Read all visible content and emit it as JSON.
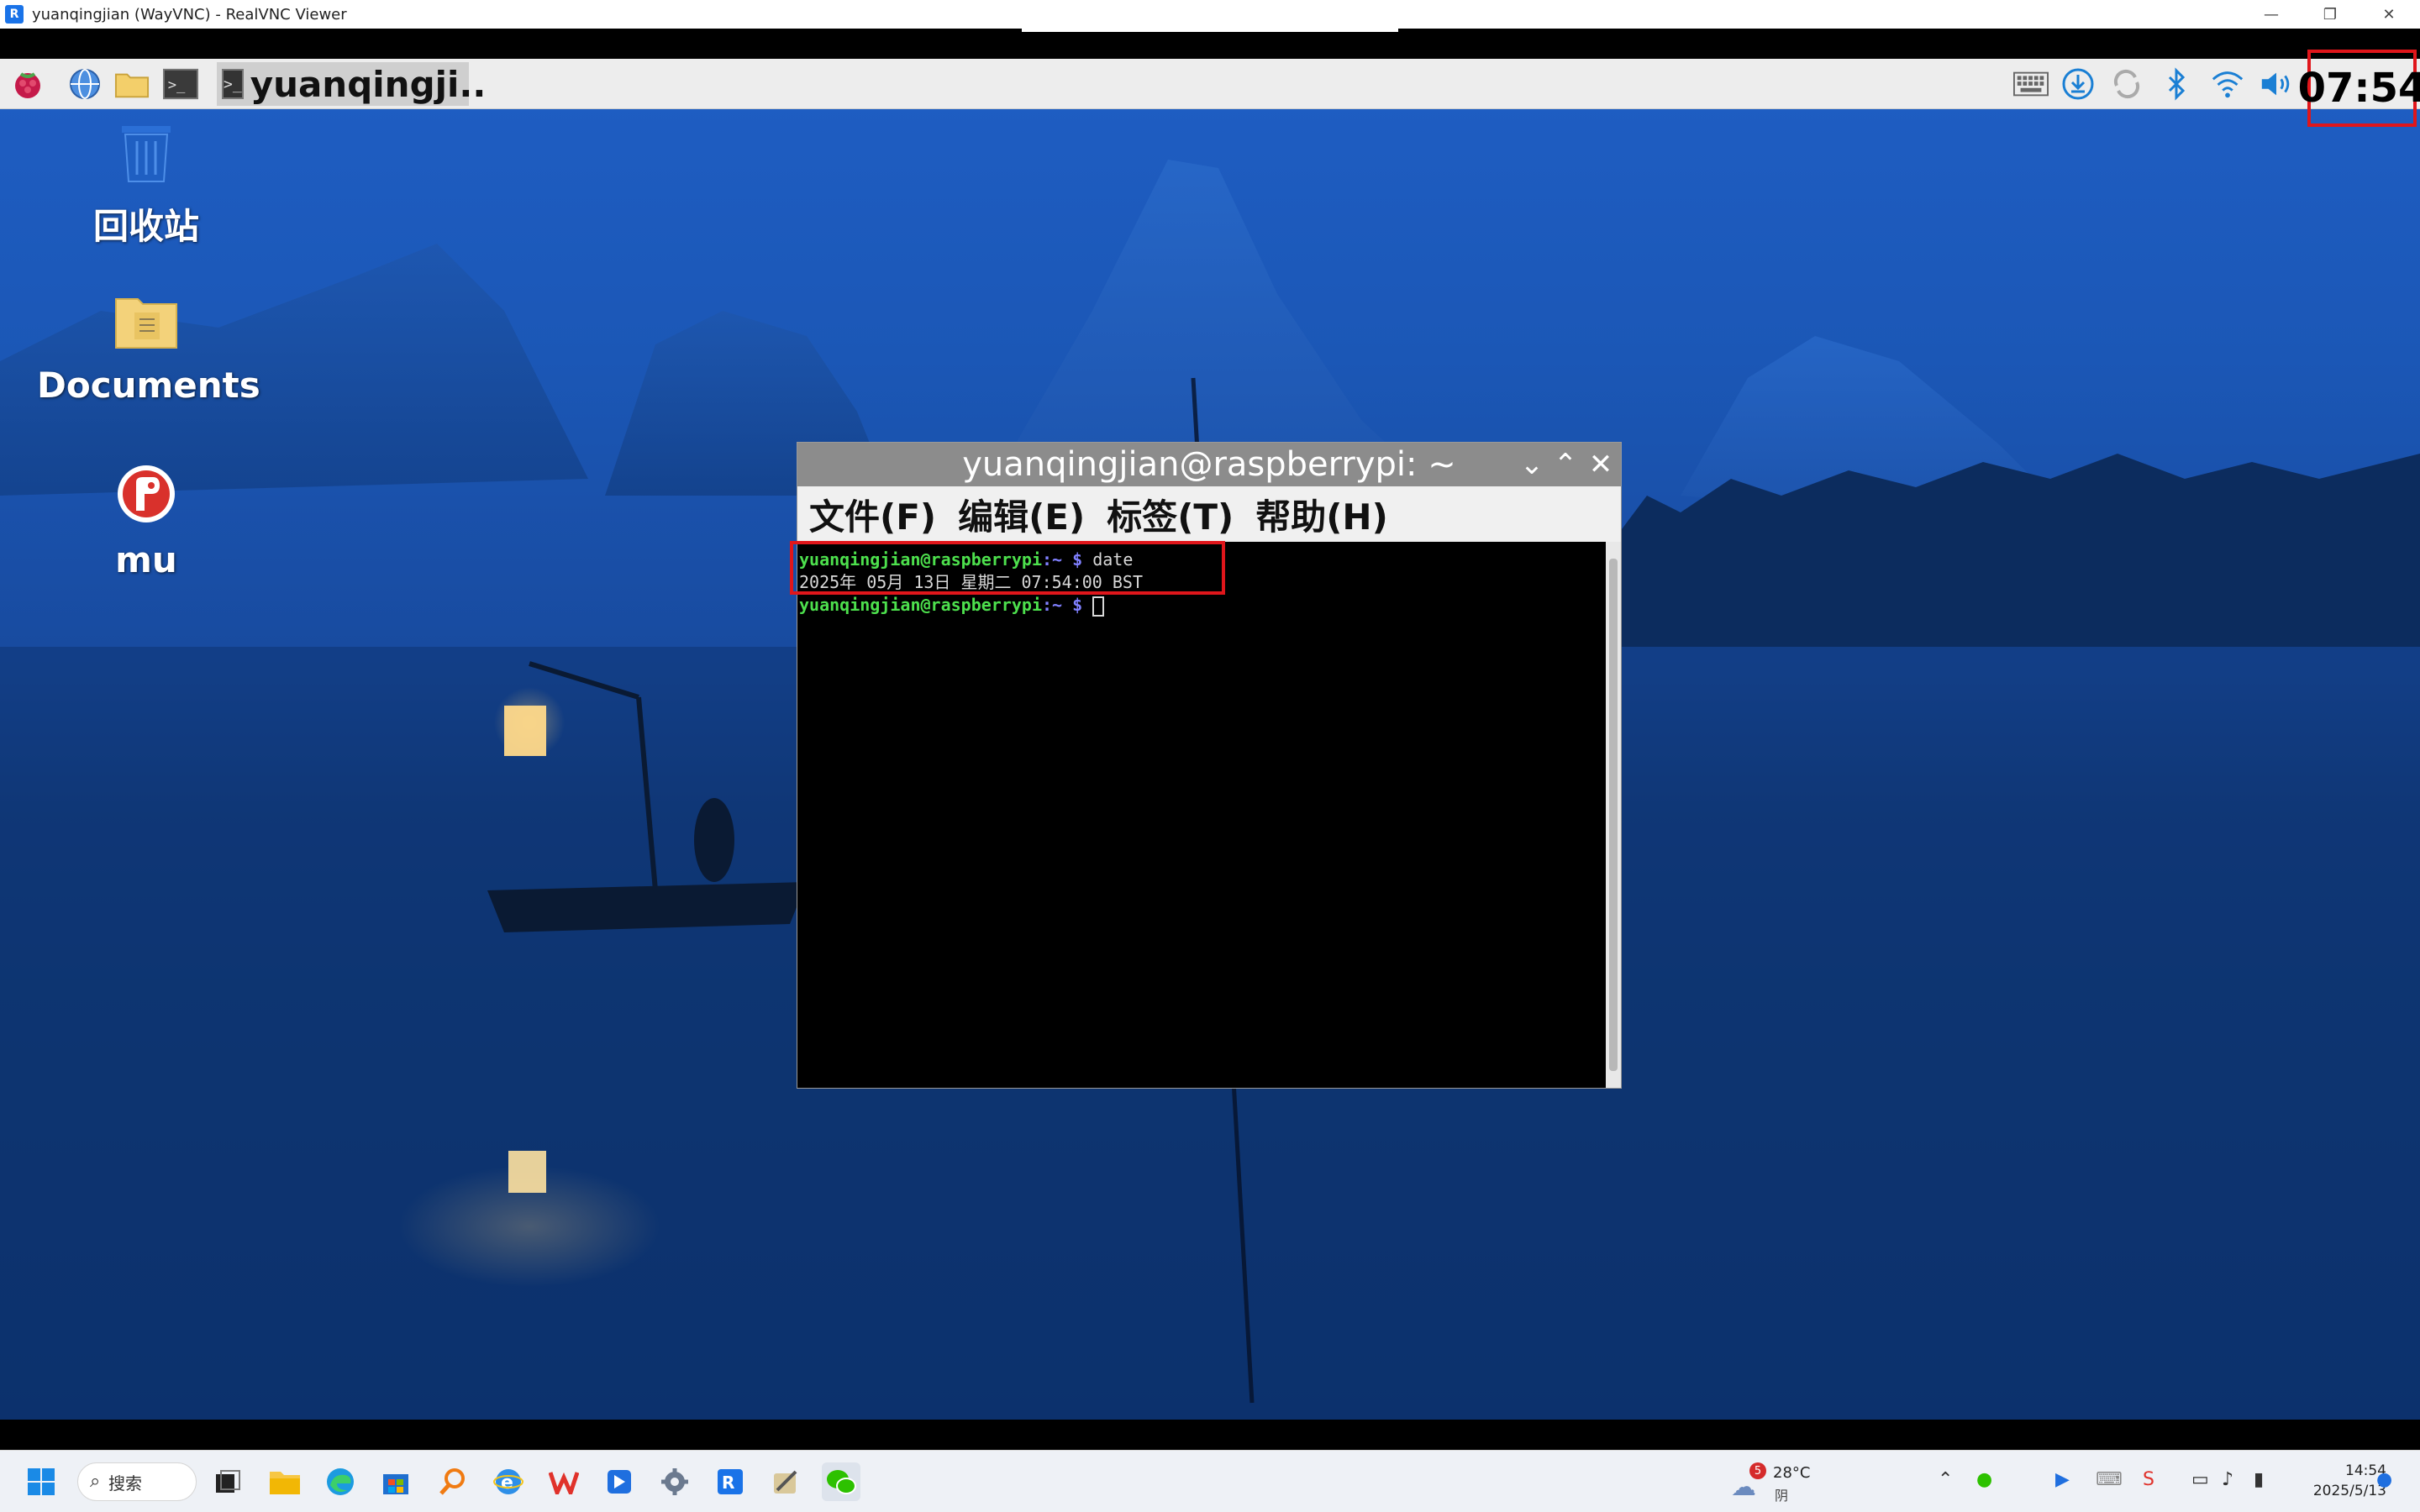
{
  "vnc_window": {
    "title": "yuanqingjian (WayVNC) - RealVNC Viewer",
    "app_icon_glyph": "R",
    "minimize_glyph": "—",
    "restore_glyph": "❐",
    "close_glyph": "✕"
  },
  "rpi_panel": {
    "task_button_label": "yuanqingji..",
    "task_button_glyph": ">_",
    "clock": "07:54"
  },
  "desktop_icons": [
    {
      "label": "回收站",
      "icon": "trash-icon"
    },
    {
      "label": "Documents",
      "icon": "folder-icon"
    },
    {
      "label": "mu",
      "icon": "mu-editor-icon"
    }
  ],
  "terminal": {
    "title": "yuanqingjian@raspberrypi: ~",
    "controls": {
      "minimize": "⌄",
      "maximize": "⌃",
      "close": "✕"
    },
    "menu": [
      "文件(F)",
      "编辑(E)",
      "标签(T)",
      "帮助(H)"
    ],
    "prompt_user": "yuanqingjian@raspberrypi",
    "prompt_sep": ":~ $",
    "command": " date",
    "output": "2025年 05月 13日 星期二 07:54:00 BST"
  },
  "win_taskbar": {
    "search_label": "搜索",
    "weather_badge": "5",
    "weather_temp": "28°C",
    "weather_cond": "阴",
    "time": "14:54",
    "date": "2025/5/13"
  },
  "colors": {
    "highlight_red": "#e0161b",
    "prompt_green": "#4de04d",
    "prompt_blue": "#8080ff",
    "desktop_blue": "#1b57b6"
  }
}
